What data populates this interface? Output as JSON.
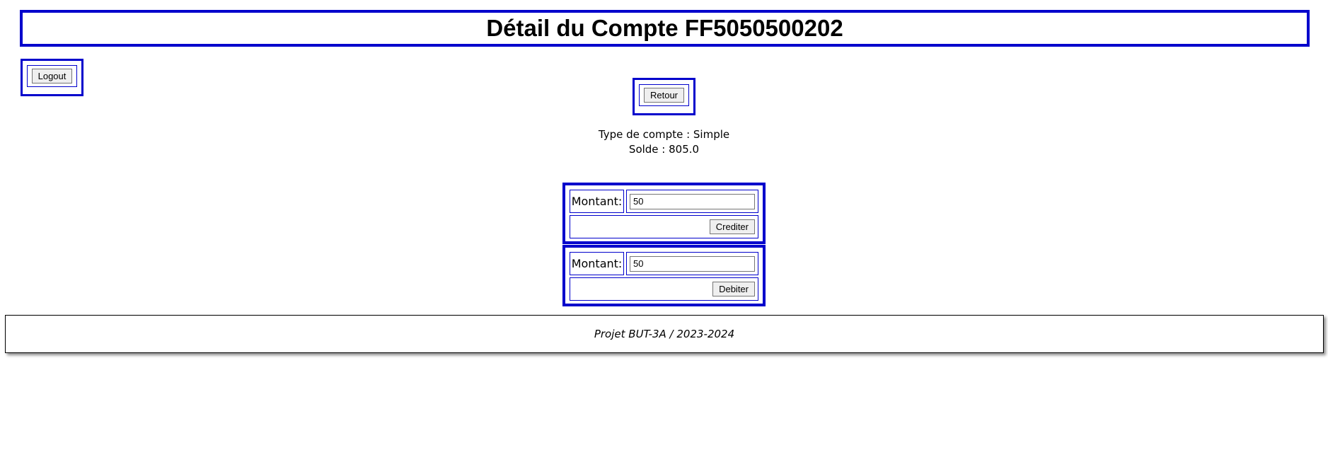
{
  "header": {
    "title": "Détail du Compte FF5050500202"
  },
  "nav": {
    "logout_label": "Logout",
    "retour_label": "Retour"
  },
  "account": {
    "type_text": "Type de compte : Simple",
    "solde_text": "Solde : 805.0"
  },
  "credit_form": {
    "label": "Montant:",
    "value": "50",
    "button_label": "Crediter"
  },
  "debit_form": {
    "label": "Montant:",
    "value": "50",
    "button_label": "Debiter"
  },
  "footer": {
    "text": "Projet BUT-3A / 2023-2024"
  },
  "colors": {
    "accent_border": "#0000cc"
  }
}
